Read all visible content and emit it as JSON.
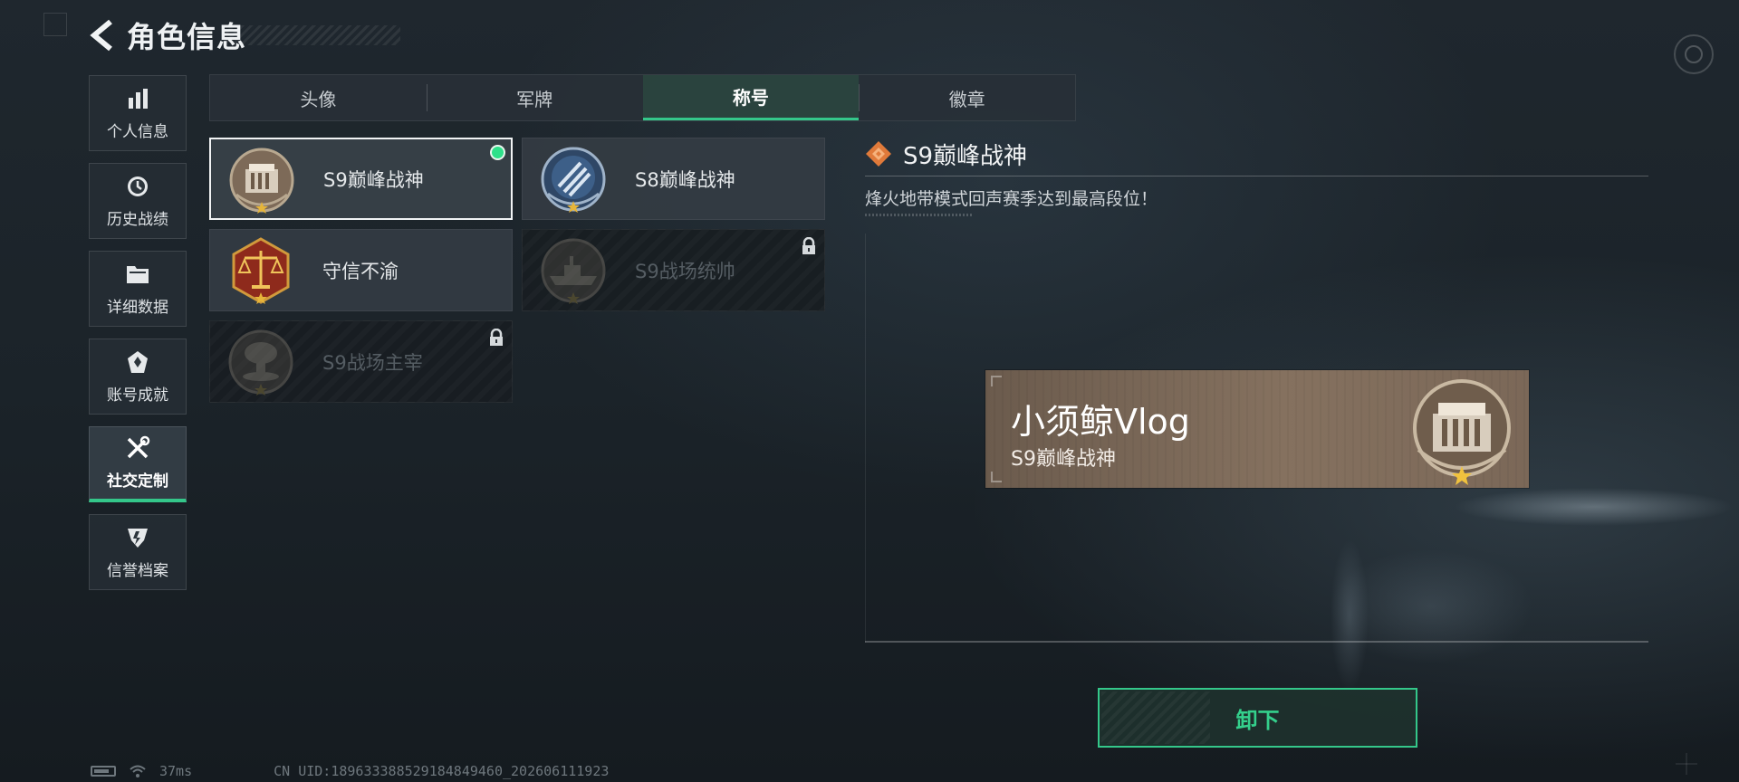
{
  "header": {
    "title": "角色信息",
    "back_icon": "chevron-left-icon"
  },
  "sidebar": {
    "items": [
      {
        "label": "个人信息",
        "icon": "bar-chart-icon",
        "active": false
      },
      {
        "label": "历史战绩",
        "icon": "history-clock-icon",
        "active": false
      },
      {
        "label": "详细数据",
        "icon": "folder-icon",
        "active": false
      },
      {
        "label": "账号成就",
        "icon": "medal-icon",
        "active": false
      },
      {
        "label": "社交定制",
        "icon": "tools-icon",
        "active": true
      },
      {
        "label": "信誉档案",
        "icon": "shield-badge-icon",
        "active": false
      }
    ]
  },
  "tabs": [
    {
      "label": "头像",
      "active": false
    },
    {
      "label": "军牌",
      "active": false
    },
    {
      "label": "称号",
      "active": true
    },
    {
      "label": "徽章",
      "active": false
    }
  ],
  "titles": [
    {
      "label": "S9巅峰战神",
      "emblem": "dam-emblem-icon",
      "selected": true,
      "equipped": true,
      "locked": false
    },
    {
      "label": "S8巅峰战神",
      "emblem": "striped-globe-emblem-icon",
      "selected": false,
      "equipped": false,
      "locked": false
    },
    {
      "label": "守信不渝",
      "emblem": "scales-emblem-icon",
      "selected": false,
      "equipped": false,
      "locked": false
    },
    {
      "label": "S9战场统帅",
      "emblem": "warship-emblem-icon",
      "selected": false,
      "equipped": false,
      "locked": true
    },
    {
      "label": "S9战场主宰",
      "emblem": "mushroom-cloud-emblem-icon",
      "selected": false,
      "equipped": false,
      "locked": true
    }
  ],
  "detail": {
    "title": "S9巅峰战神",
    "title_icon": "diamond-icon",
    "description": "烽火地带模式回声赛季达到最高段位！"
  },
  "nameplate": {
    "player_name": "小须鲸Vlog",
    "title": "S9巅峰战神",
    "emblem": "dam-emblem-icon"
  },
  "actions": {
    "unequip_label": "卸下"
  },
  "status": {
    "ping": "37ms",
    "uid": "CN UID:1896333885291848494​60_202606111923"
  },
  "colors": {
    "accent_green": "#34c78a",
    "equipped_dot": "#2ee08a",
    "diamond_orange": "#e07a3a"
  }
}
